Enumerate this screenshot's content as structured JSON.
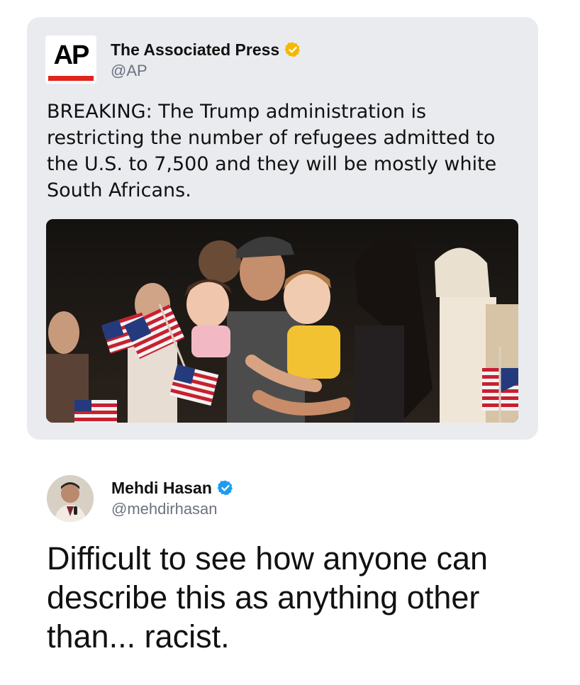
{
  "quoted_post": {
    "author_name": "The Associated Press",
    "author_handle": "@AP",
    "verified_badge": "gold-verified-icon",
    "logo_text": "AP",
    "text": "BREAKING: The Trump administration is restricting the number of refugees admitted to the U.S. to 7,500 and they will be mostly white South Africans.",
    "media": "photo of families waving small American flags"
  },
  "post": {
    "author_name": "Mehdi Hasan",
    "author_handle": "@mehdirhasan",
    "verified_badge": "blue-verified-icon",
    "text": "Difficult to see how anyone can describe this as anything other than... racist."
  },
  "colors": {
    "card_background": "#e9ebee",
    "gold_badge": "#f5b800",
    "blue_badge": "#1d9bf0",
    "handle_gray": "#6b7280",
    "ap_red": "#e1251b"
  }
}
